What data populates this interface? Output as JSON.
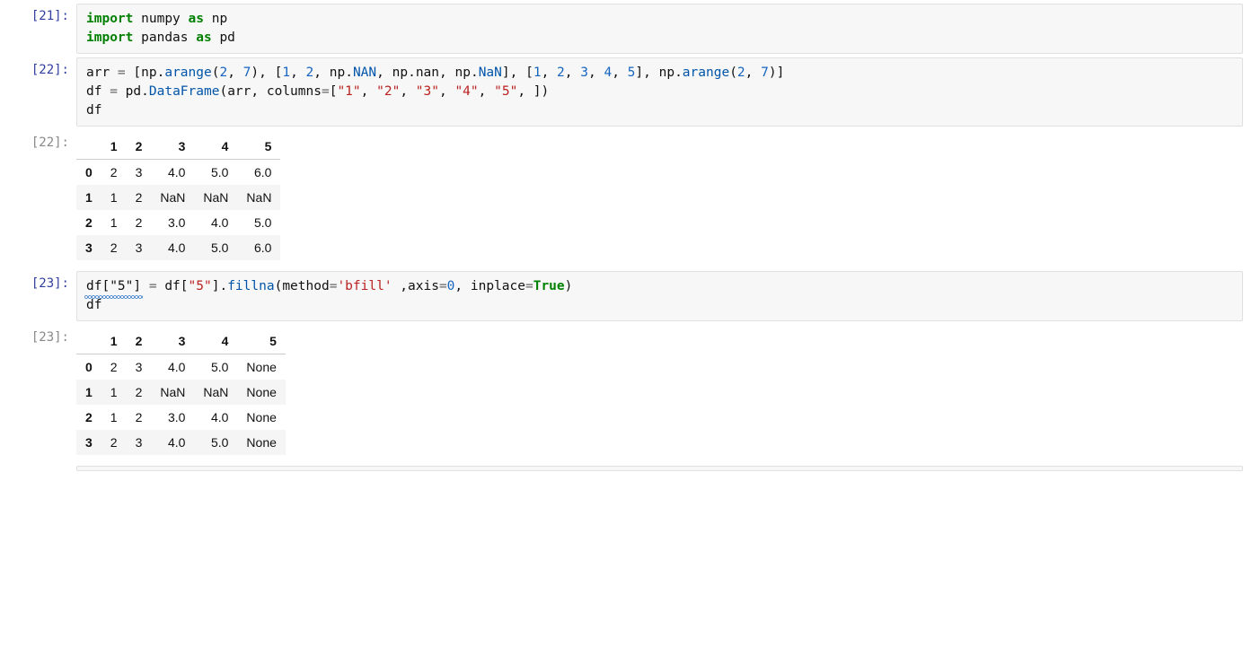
{
  "cells": [
    {
      "prompt": "[21]:",
      "type": "code",
      "code_tokens": [
        [
          {
            "t": "import",
            "c": "tok-kw"
          },
          {
            "t": " "
          },
          {
            "t": "numpy",
            "c": "tok-name"
          },
          {
            "t": " "
          },
          {
            "t": "as",
            "c": "tok-kw"
          },
          {
            "t": " "
          },
          {
            "t": "np",
            "c": "tok-name"
          }
        ],
        [
          {
            "t": "import",
            "c": "tok-kw"
          },
          {
            "t": " "
          },
          {
            "t": "pandas",
            "c": "tok-name"
          },
          {
            "t": " "
          },
          {
            "t": "as",
            "c": "tok-kw"
          },
          {
            "t": " "
          },
          {
            "t": "pd",
            "c": "tok-name"
          }
        ]
      ]
    },
    {
      "prompt": "[22]:",
      "type": "code",
      "code_tokens": [
        [
          {
            "t": "arr",
            "c": "tok-name"
          },
          {
            "t": " = ",
            "c": "tok-op"
          },
          {
            "t": "[",
            "c": "tok-punct"
          },
          {
            "t": "np",
            "c": "tok-name"
          },
          {
            "t": ".",
            "c": "tok-punct"
          },
          {
            "t": "arange",
            "c": "tok-func"
          },
          {
            "t": "(",
            "c": "tok-punct"
          },
          {
            "t": "2",
            "c": "tok-num"
          },
          {
            "t": ", ",
            "c": "tok-punct"
          },
          {
            "t": "7",
            "c": "tok-num"
          },
          {
            "t": ")",
            "c": "tok-punct"
          },
          {
            "t": ", ",
            "c": "tok-punct"
          },
          {
            "t": "[",
            "c": "tok-punct"
          },
          {
            "t": "1",
            "c": "tok-num"
          },
          {
            "t": ", ",
            "c": "tok-punct"
          },
          {
            "t": "2",
            "c": "tok-num"
          },
          {
            "t": ", ",
            "c": "tok-punct"
          },
          {
            "t": "np",
            "c": "tok-name"
          },
          {
            "t": ".",
            "c": "tok-punct"
          },
          {
            "t": "NAN",
            "c": "tok-attr"
          },
          {
            "t": ", ",
            "c": "tok-punct"
          },
          {
            "t": "np",
            "c": "tok-name"
          },
          {
            "t": ".",
            "c": "tok-punct"
          },
          {
            "t": "nan",
            "c": "tok-name"
          },
          {
            "t": ", ",
            "c": "tok-punct"
          },
          {
            "t": "np",
            "c": "tok-name"
          },
          {
            "t": ".",
            "c": "tok-punct"
          },
          {
            "t": "NaN",
            "c": "tok-attr"
          },
          {
            "t": "]",
            "c": "tok-punct"
          },
          {
            "t": ", ",
            "c": "tok-punct"
          },
          {
            "t": "[",
            "c": "tok-punct"
          },
          {
            "t": "1",
            "c": "tok-num"
          },
          {
            "t": ", ",
            "c": "tok-punct"
          },
          {
            "t": "2",
            "c": "tok-num"
          },
          {
            "t": ", ",
            "c": "tok-punct"
          },
          {
            "t": "3",
            "c": "tok-num"
          },
          {
            "t": ", ",
            "c": "tok-punct"
          },
          {
            "t": "4",
            "c": "tok-num"
          },
          {
            "t": ", ",
            "c": "tok-punct"
          },
          {
            "t": "5",
            "c": "tok-num"
          },
          {
            "t": "]",
            "c": "tok-punct"
          },
          {
            "t": ", ",
            "c": "tok-punct"
          },
          {
            "t": "np",
            "c": "tok-name"
          },
          {
            "t": ".",
            "c": "tok-punct"
          },
          {
            "t": "arange",
            "c": "tok-func"
          },
          {
            "t": "(",
            "c": "tok-punct"
          },
          {
            "t": "2",
            "c": "tok-num"
          },
          {
            "t": ", ",
            "c": "tok-punct"
          },
          {
            "t": "7",
            "c": "tok-num"
          },
          {
            "t": ")",
            "c": "tok-punct"
          },
          {
            "t": "]",
            "c": "tok-punct"
          }
        ],
        [
          {
            "t": "df",
            "c": "tok-name"
          },
          {
            "t": " = ",
            "c": "tok-op"
          },
          {
            "t": "pd",
            "c": "tok-name"
          },
          {
            "t": ".",
            "c": "tok-punct"
          },
          {
            "t": "DataFrame",
            "c": "tok-func"
          },
          {
            "t": "(",
            "c": "tok-punct"
          },
          {
            "t": "arr",
            "c": "tok-name"
          },
          {
            "t": ", ",
            "c": "tok-punct"
          },
          {
            "t": "columns",
            "c": "tok-name"
          },
          {
            "t": "=",
            "c": "tok-op"
          },
          {
            "t": "[",
            "c": "tok-punct"
          },
          {
            "t": "\"1\"",
            "c": "tok-str"
          },
          {
            "t": ", ",
            "c": "tok-punct"
          },
          {
            "t": "\"2\"",
            "c": "tok-str"
          },
          {
            "t": ", ",
            "c": "tok-punct"
          },
          {
            "t": "\"3\"",
            "c": "tok-str"
          },
          {
            "t": ", ",
            "c": "tok-punct"
          },
          {
            "t": "\"4\"",
            "c": "tok-str"
          },
          {
            "t": ", ",
            "c": "tok-punct"
          },
          {
            "t": "\"5\"",
            "c": "tok-str"
          },
          {
            "t": ", ",
            "c": "tok-punct"
          },
          {
            "t": "]",
            "c": "tok-punct"
          },
          {
            "t": ")",
            "c": "tok-punct"
          }
        ],
        [
          {
            "t": "df",
            "c": "tok-name"
          }
        ]
      ]
    },
    {
      "prompt": "[22]:",
      "type": "df",
      "df": {
        "columns": [
          "1",
          "2",
          "3",
          "4",
          "5"
        ],
        "index": [
          "0",
          "1",
          "2",
          "3"
        ],
        "rows": [
          [
            "2",
            "3",
            "4.0",
            "5.0",
            "6.0"
          ],
          [
            "1",
            "2",
            "NaN",
            "NaN",
            "NaN"
          ],
          [
            "1",
            "2",
            "3.0",
            "4.0",
            "5.0"
          ],
          [
            "2",
            "3",
            "4.0",
            "5.0",
            "6.0"
          ]
        ]
      }
    },
    {
      "prompt": "[23]:",
      "type": "code",
      "code_tokens": [
        [
          {
            "t": "df[\"5\"]",
            "c": "tok-name",
            "squiggle": true
          },
          {
            "t": " = ",
            "c": "tok-op"
          },
          {
            "t": "df",
            "c": "tok-name"
          },
          {
            "t": "[",
            "c": "tok-punct"
          },
          {
            "t": "\"5\"",
            "c": "tok-str"
          },
          {
            "t": "]",
            "c": "tok-punct"
          },
          {
            "t": ".",
            "c": "tok-punct"
          },
          {
            "t": "fillna",
            "c": "tok-func"
          },
          {
            "t": "(",
            "c": "tok-punct"
          },
          {
            "t": "method",
            "c": "tok-name"
          },
          {
            "t": "=",
            "c": "tok-op"
          },
          {
            "t": "'bfill'",
            "c": "tok-str"
          },
          {
            "t": " ,",
            "c": "tok-punct"
          },
          {
            "t": "axis",
            "c": "tok-name"
          },
          {
            "t": "=",
            "c": "tok-op"
          },
          {
            "t": "0",
            "c": "tok-num"
          },
          {
            "t": ", ",
            "c": "tok-punct"
          },
          {
            "t": "inplace",
            "c": "tok-name"
          },
          {
            "t": "=",
            "c": "tok-op"
          },
          {
            "t": "True",
            "c": "tok-kw2"
          },
          {
            "t": ")",
            "c": "tok-punct"
          }
        ],
        [
          {
            "t": "df",
            "c": "tok-name"
          }
        ]
      ]
    },
    {
      "prompt": "[23]:",
      "type": "df",
      "df": {
        "columns": [
          "1",
          "2",
          "3",
          "4",
          "5"
        ],
        "index": [
          "0",
          "1",
          "2",
          "3"
        ],
        "rows": [
          [
            "2",
            "3",
            "4.0",
            "5.0",
            "None"
          ],
          [
            "1",
            "2",
            "NaN",
            "NaN",
            "None"
          ],
          [
            "1",
            "2",
            "3.0",
            "4.0",
            "None"
          ],
          [
            "2",
            "3",
            "4.0",
            "5.0",
            "None"
          ]
        ]
      }
    },
    {
      "prompt": "",
      "type": "empty-code"
    }
  ]
}
